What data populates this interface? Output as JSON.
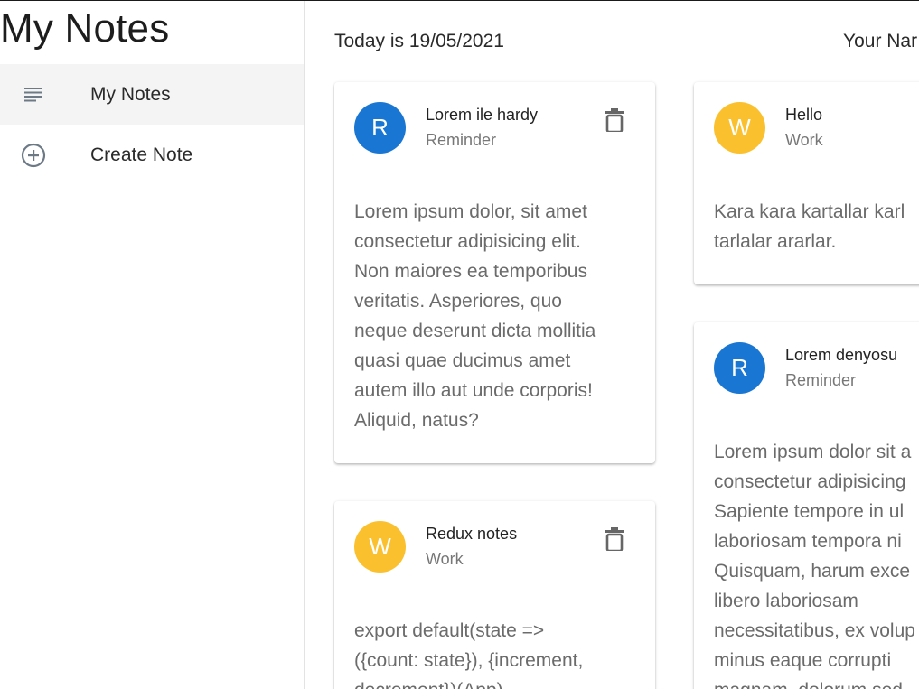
{
  "app": {
    "title": "My Notes"
  },
  "sidebar": {
    "items": [
      {
        "label": "My Notes",
        "icon": "notes-list-icon",
        "active": true
      },
      {
        "label": "Create Note",
        "icon": "add-circle-icon",
        "active": false
      }
    ]
  },
  "header": {
    "today": "Today is 19/05/2021",
    "user": "Your Nar"
  },
  "colors": {
    "reminder_avatar": "#1976d2",
    "work_avatar": "#fbc02d",
    "active_nav_bg": "#f4f4f4"
  },
  "notes": [
    {
      "initial": "R",
      "title": "Lorem ile hardy",
      "category": "Reminder",
      "body": [
        "Lorem ipsum dolor, sit amet",
        "consectetur adipisicing elit.",
        "Non maiores ea temporibus",
        "veritatis. Asperiores, quo",
        "neque deserunt dicta mollitia",
        "quasi quae ducimus amet",
        "autem illo aut unde corporis!",
        "Aliquid, natus?"
      ]
    },
    {
      "initial": "W",
      "title": "Redux notes",
      "category": "Work",
      "body": [
        "export default(state =>",
        "({count: state}), {increment,",
        "decrement})(App)"
      ]
    },
    {
      "initial": "W",
      "title": "Hello",
      "category": "Work",
      "body": [
        "Kara kara kartallar karl",
        "tarlalar ararlar."
      ]
    },
    {
      "initial": "R",
      "title": "Lorem denyosu",
      "category": "Reminder",
      "body": [
        "Lorem ipsum dolor sit a",
        "consectetur adipisicing",
        "Sapiente tempore in ul",
        "laboriosam tempora ni",
        "Quisquam, harum exce",
        "libero laboriosam",
        "necessitatibus, ex volup",
        "minus eaque corrupti",
        "magnam, dolorum sed"
      ]
    }
  ]
}
